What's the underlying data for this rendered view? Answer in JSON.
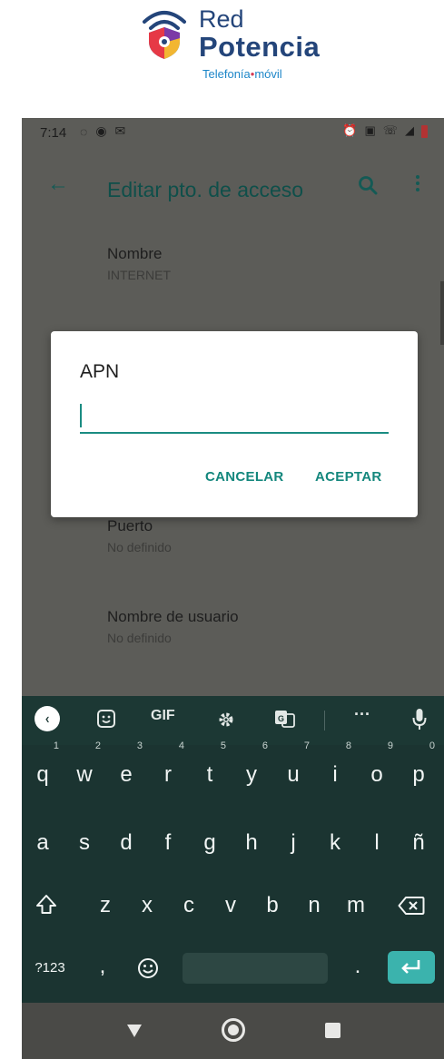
{
  "logo": {
    "line1": "Red",
    "line2": "Potencia",
    "tagline_part1": "Telefonía",
    "tagline_dot": "•",
    "tagline_part2": "móvil"
  },
  "status_bar": {
    "time": "7:14"
  },
  "app_bar": {
    "title": "Editar pto. de acceso"
  },
  "preferences": [
    {
      "title": "Nombre",
      "summary": "INTERNET"
    },
    {
      "title": "Puerto",
      "summary": "No definido"
    },
    {
      "title": "Nombre de usuario",
      "summary": "No definido"
    }
  ],
  "dialog": {
    "title": "APN",
    "input_value": "",
    "cancel_label": "CANCELAR",
    "accept_label": "ACEPTAR"
  },
  "keyboard": {
    "toolbar": {
      "gif_label": "GIF",
      "more_label": "···"
    },
    "row1": [
      "q",
      "w",
      "e",
      "r",
      "t",
      "y",
      "u",
      "i",
      "o",
      "p"
    ],
    "row1_hints": [
      "1",
      "2",
      "3",
      "4",
      "5",
      "6",
      "7",
      "8",
      "9",
      "0"
    ],
    "row2": [
      "a",
      "s",
      "d",
      "f",
      "g",
      "h",
      "j",
      "k",
      "l",
      "ñ"
    ],
    "row3": [
      "z",
      "x",
      "c",
      "v",
      "b",
      "n",
      "m"
    ],
    "symbols_label": "?123",
    "comma_label": ",",
    "period_label": "."
  },
  "colors": {
    "accent": "#1a8c82",
    "keyboard_bg": "#1b3431",
    "enter_key": "#3bb3ad",
    "scrim": "#5c5c58",
    "brand_navy": "#24457a"
  }
}
